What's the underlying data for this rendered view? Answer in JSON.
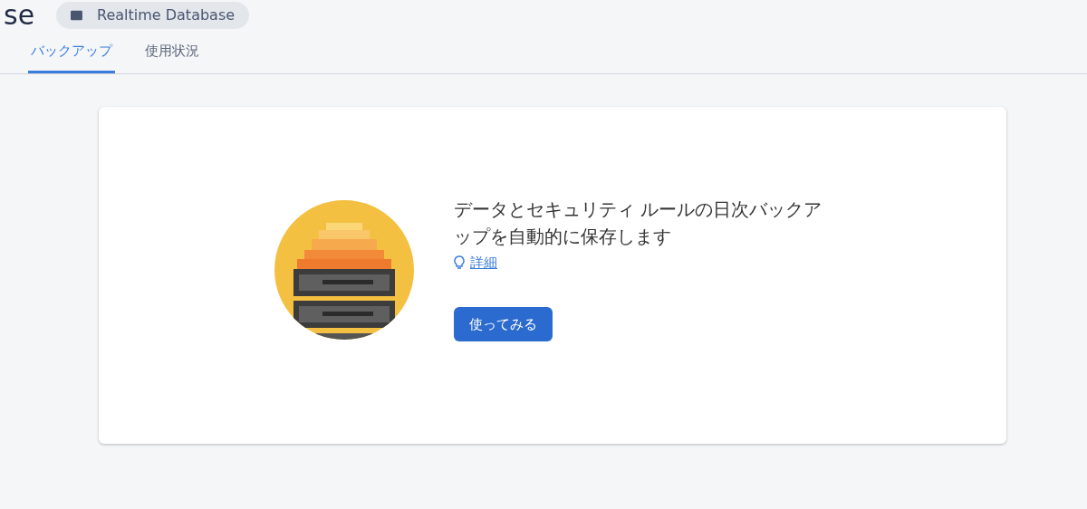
{
  "header": {
    "title": "se",
    "chip": {
      "label": "Realtime Database"
    }
  },
  "tabs": [
    {
      "label": "バックアップ",
      "selected": true
    },
    {
      "label": "使用状況",
      "selected": false
    }
  ],
  "card": {
    "heading": "データとセキュリティ ルールの日次バックアップを自動的に保存します",
    "link": "詳細",
    "button": "使ってみる"
  }
}
